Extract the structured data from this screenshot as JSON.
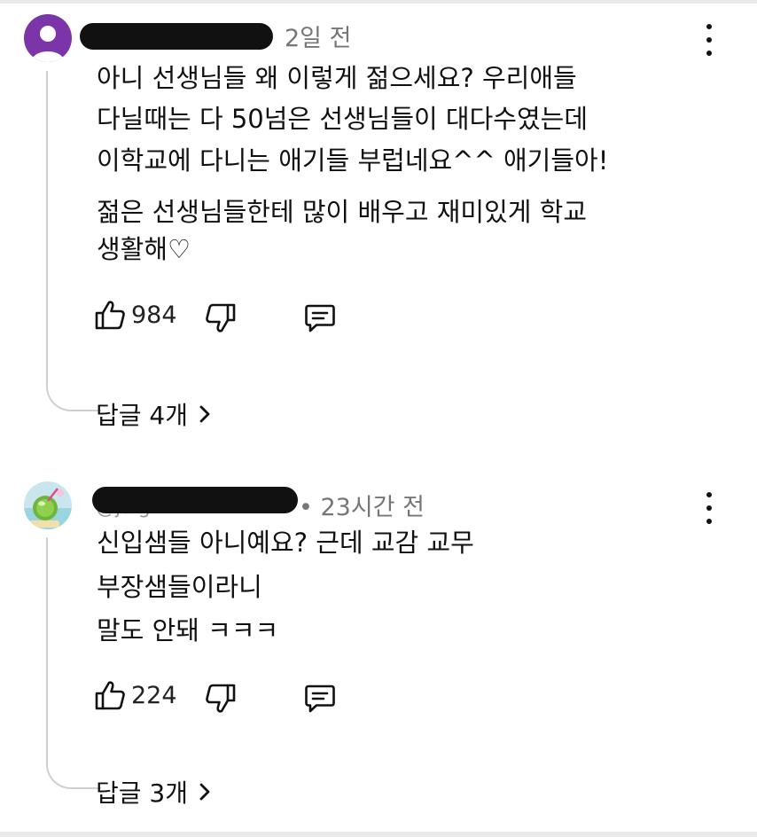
{
  "comments": [
    {
      "avatar": "purple-default-person-avatar",
      "time": "2일 전",
      "body": [
        "아니 선생님들 왜 이렇게 젊으세요?  우리애들",
        "다닐때는 다 50넘은 선생님들이 대다수였는데",
        "이학교에 다니는 애기들 부럽네요^^ 애기들아!",
        "젊은 선생님들한테 많이 배우고 재미있게 학교",
        "생활해♡"
      ],
      "likes": "984",
      "replies": "답글 4개"
    },
    {
      "avatar": "green-coconut-drink-avatar",
      "time": "• 23시간 전",
      "handle_partial": "@jaig",
      "body": [
        "신입샘들 아니예요?  근데 교감 교무",
        "부장샘들이라니",
        "말도 안돼 ㅋㅋㅋ"
      ],
      "likes": "224",
      "replies": "답글 3개"
    }
  ],
  "icons": {
    "like": "thumbs-up-icon",
    "dislike": "thumbs-down-icon",
    "reply": "comment-icon",
    "menu": "more-vertical-icon",
    "chevron": "chevron-right-icon"
  }
}
